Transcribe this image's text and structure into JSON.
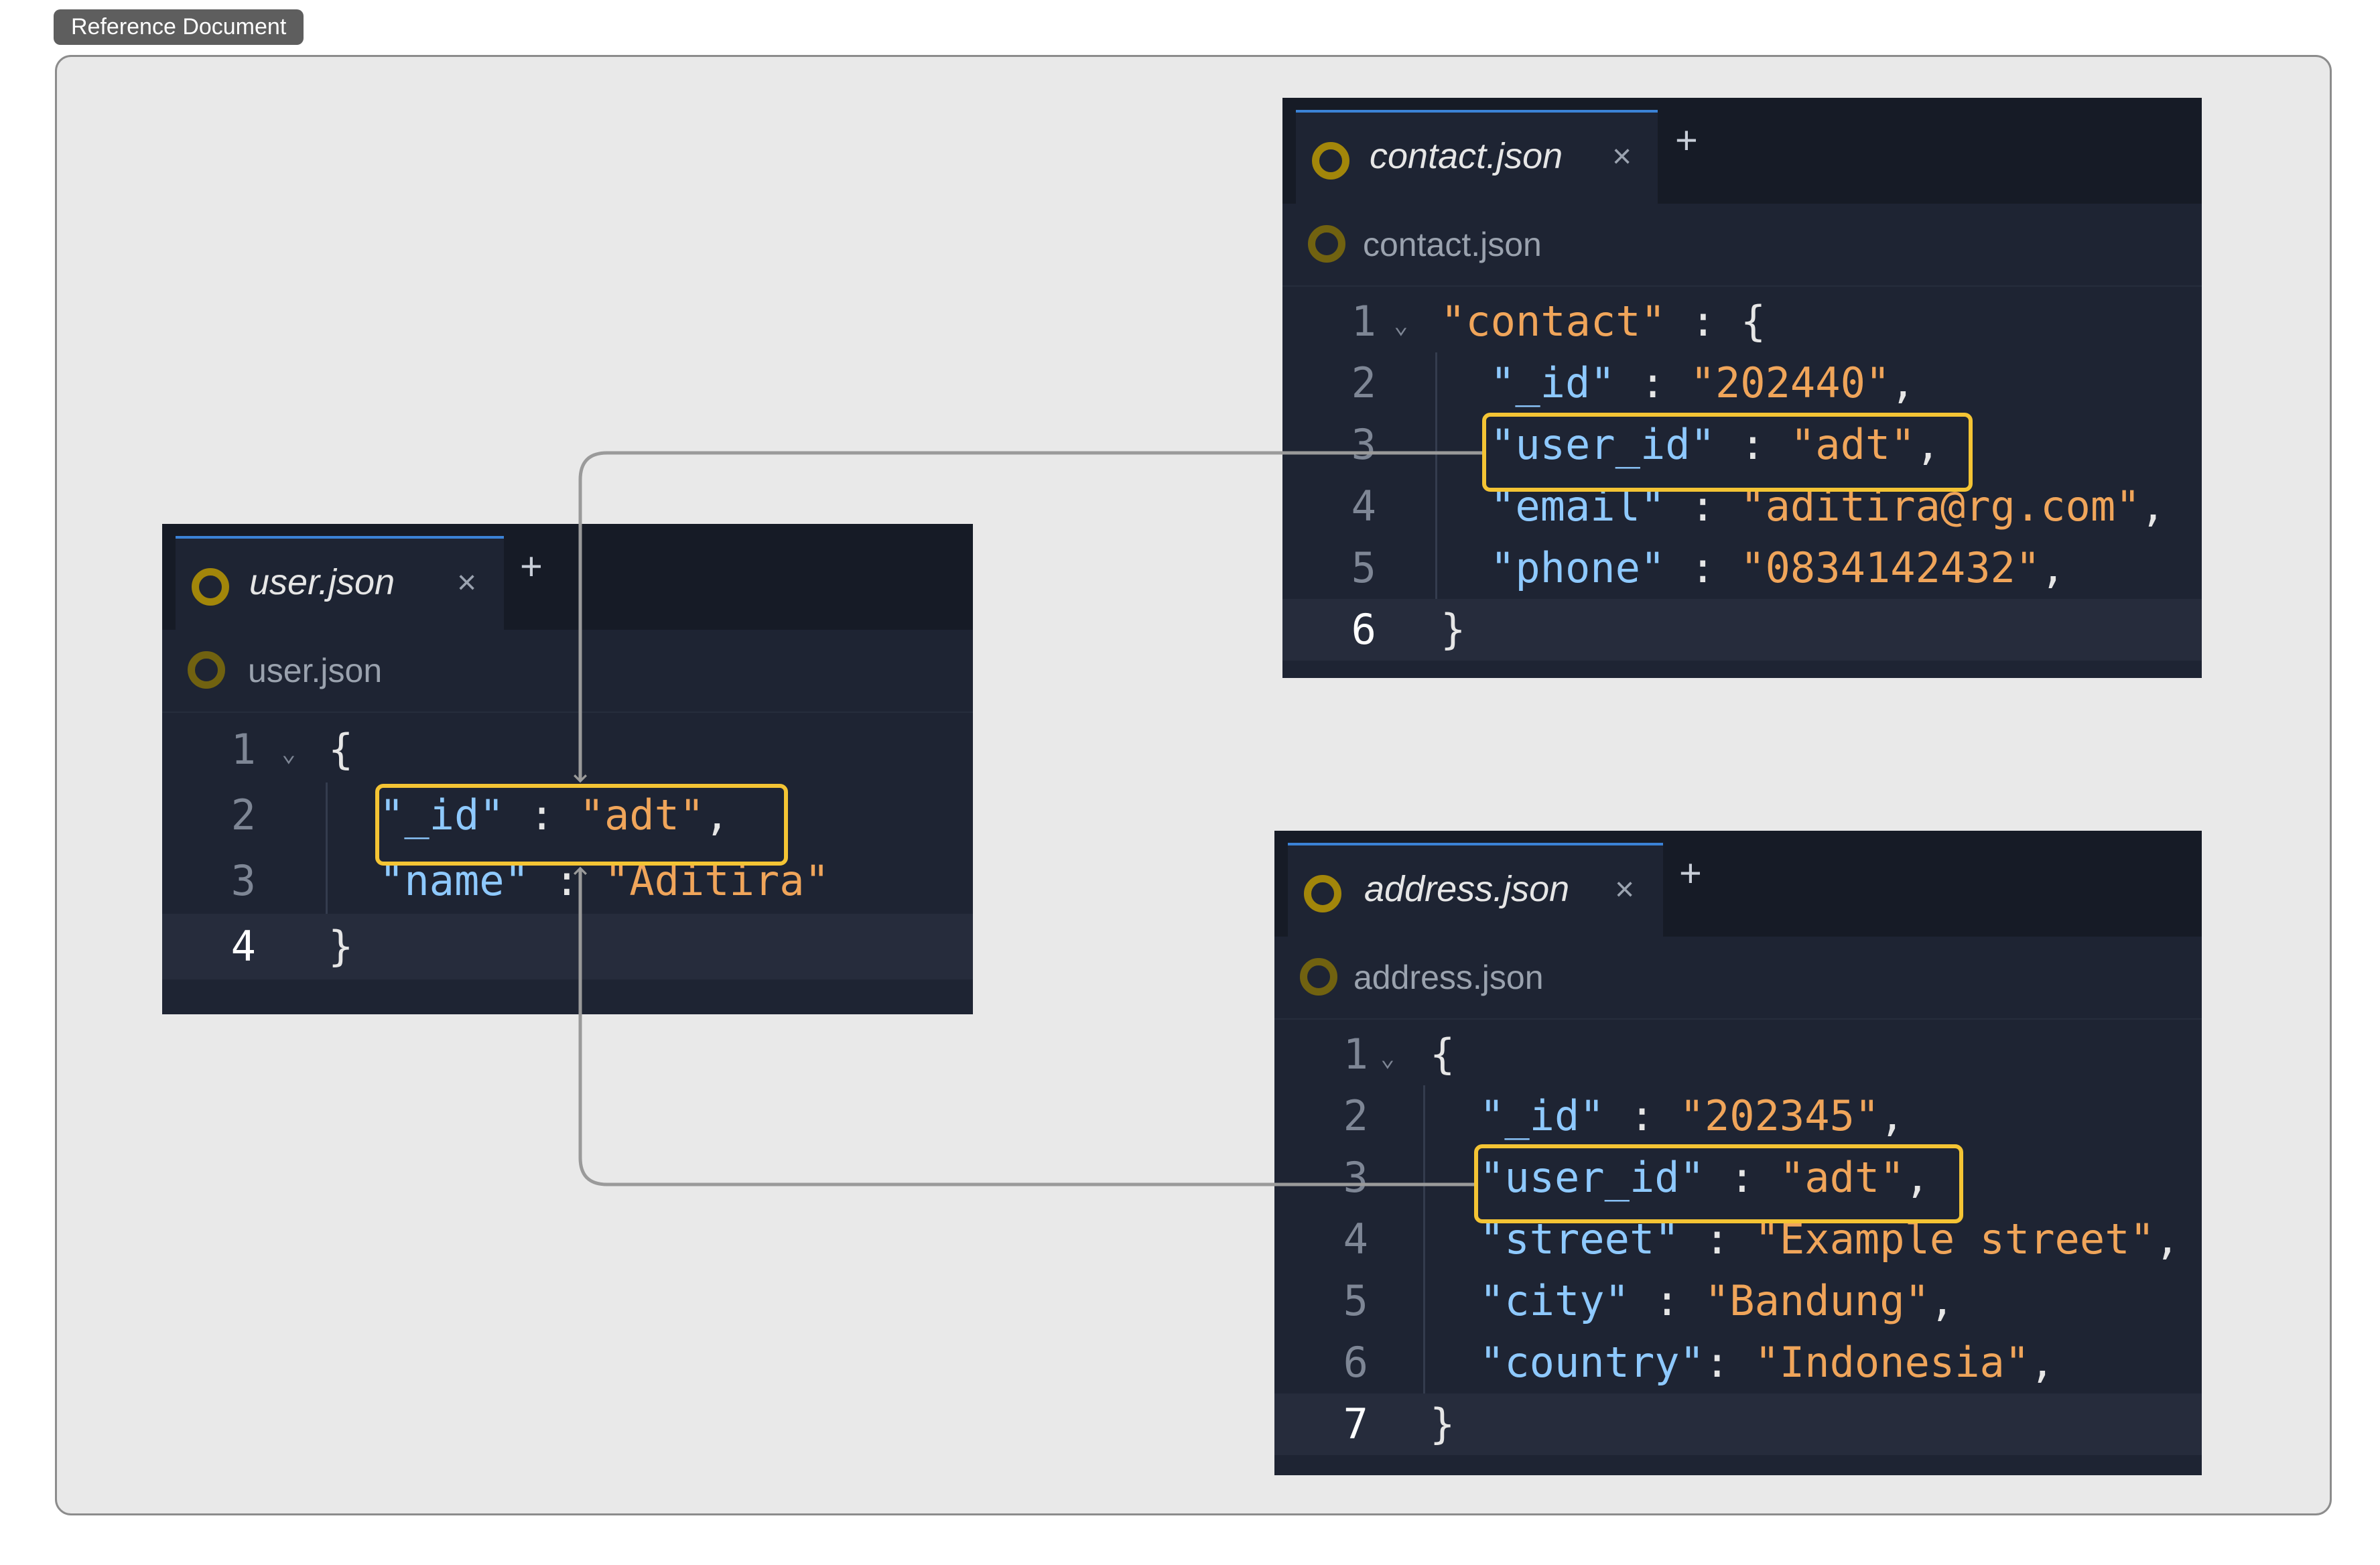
{
  "header_label": "Reference Document",
  "editors": {
    "user": {
      "tab_label": "user.json",
      "breadcrumb": "user.json",
      "lines": [
        {
          "num": "1",
          "indent": false,
          "parts": [
            {
              "c": "p",
              "t": "{"
            }
          ]
        },
        {
          "num": "2",
          "indent": true,
          "parts": [
            {
              "c": "k",
              "t": "\"_id\""
            },
            {
              "c": "p",
              "t": " : "
            },
            {
              "c": "s",
              "t": "\"adt\""
            },
            {
              "c": "p",
              "t": ","
            }
          ]
        },
        {
          "num": "3",
          "indent": true,
          "parts": [
            {
              "c": "k",
              "t": "\"name\""
            },
            {
              "c": "p",
              "t": " : "
            },
            {
              "c": "s",
              "t": "\"Aditira\""
            }
          ]
        },
        {
          "num": "4",
          "indent": false,
          "parts": [
            {
              "c": "p",
              "t": "}"
            }
          ]
        }
      ]
    },
    "contact": {
      "tab_label": "contact.json",
      "breadcrumb": "contact.json",
      "lines": [
        {
          "num": "1",
          "indent": false,
          "parts": [
            {
              "c": "s",
              "t": "\"contact\""
            },
            {
              "c": "p",
              "t": " : {"
            }
          ]
        },
        {
          "num": "2",
          "indent": true,
          "parts": [
            {
              "c": "k",
              "t": "\"_id\""
            },
            {
              "c": "p",
              "t": " : "
            },
            {
              "c": "s",
              "t": "\"202440\""
            },
            {
              "c": "p",
              "t": ","
            }
          ]
        },
        {
          "num": "3",
          "indent": true,
          "parts": [
            {
              "c": "k",
              "t": "\"user_id\""
            },
            {
              "c": "p",
              "t": " : "
            },
            {
              "c": "s",
              "t": "\"adt\""
            },
            {
              "c": "p",
              "t": ","
            }
          ]
        },
        {
          "num": "4",
          "indent": true,
          "parts": [
            {
              "c": "k",
              "t": "\"email\""
            },
            {
              "c": "p",
              "t": " : "
            },
            {
              "c": "s",
              "t": "\"aditira@rg.com\""
            },
            {
              "c": "p",
              "t": ","
            }
          ]
        },
        {
          "num": "5",
          "indent": true,
          "parts": [
            {
              "c": "k",
              "t": "\"phone\""
            },
            {
              "c": "p",
              "t": " : "
            },
            {
              "c": "s",
              "t": "\"0834142432\""
            },
            {
              "c": "p",
              "t": ","
            }
          ]
        },
        {
          "num": "6",
          "indent": false,
          "parts": [
            {
              "c": "p",
              "t": "}"
            }
          ]
        }
      ]
    },
    "address": {
      "tab_label": "address.json",
      "breadcrumb": "address.json",
      "lines": [
        {
          "num": "1",
          "indent": false,
          "parts": [
            {
              "c": "p",
              "t": "{"
            }
          ]
        },
        {
          "num": "2",
          "indent": true,
          "parts": [
            {
              "c": "k",
              "t": "\"_id\""
            },
            {
              "c": "p",
              "t": " : "
            },
            {
              "c": "s",
              "t": "\"202345\""
            },
            {
              "c": "p",
              "t": ","
            }
          ]
        },
        {
          "num": "3",
          "indent": true,
          "parts": [
            {
              "c": "k",
              "t": "\"user_id\""
            },
            {
              "c": "p",
              "t": " : "
            },
            {
              "c": "s",
              "t": "\"adt\""
            },
            {
              "c": "p",
              "t": ","
            }
          ]
        },
        {
          "num": "4",
          "indent": true,
          "parts": [
            {
              "c": "k",
              "t": "\"street\""
            },
            {
              "c": "p",
              "t": " : "
            },
            {
              "c": "s",
              "t": "\"Example street\""
            },
            {
              "c": "p",
              "t": ","
            }
          ]
        },
        {
          "num": "5",
          "indent": true,
          "parts": [
            {
              "c": "k",
              "t": "\"city\""
            },
            {
              "c": "p",
              "t": " : "
            },
            {
              "c": "s",
              "t": "\"Bandung\""
            },
            {
              "c": "p",
              "t": ","
            }
          ]
        },
        {
          "num": "6",
          "indent": true,
          "parts": [
            {
              "c": "k",
              "t": "\"country\""
            },
            {
              "c": "p",
              "t": ": "
            },
            {
              "c": "s",
              "t": "\"Indonesia\""
            },
            {
              "c": "p",
              "t": ","
            }
          ]
        },
        {
          "num": "7",
          "indent": false,
          "parts": [
            {
              "c": "p",
              "t": "}"
            }
          ]
        }
      ]
    }
  },
  "colors": {
    "editor_bg": "#1e2433",
    "tabbar_bg": "#161b26",
    "key": "#8ec9ff",
    "string": "#f0a55a",
    "highlight": "#f4c434",
    "connector": "#9a9a9a"
  },
  "icons": {
    "file": "json-file-icon",
    "close": "close-icon",
    "add": "plus-icon"
  }
}
